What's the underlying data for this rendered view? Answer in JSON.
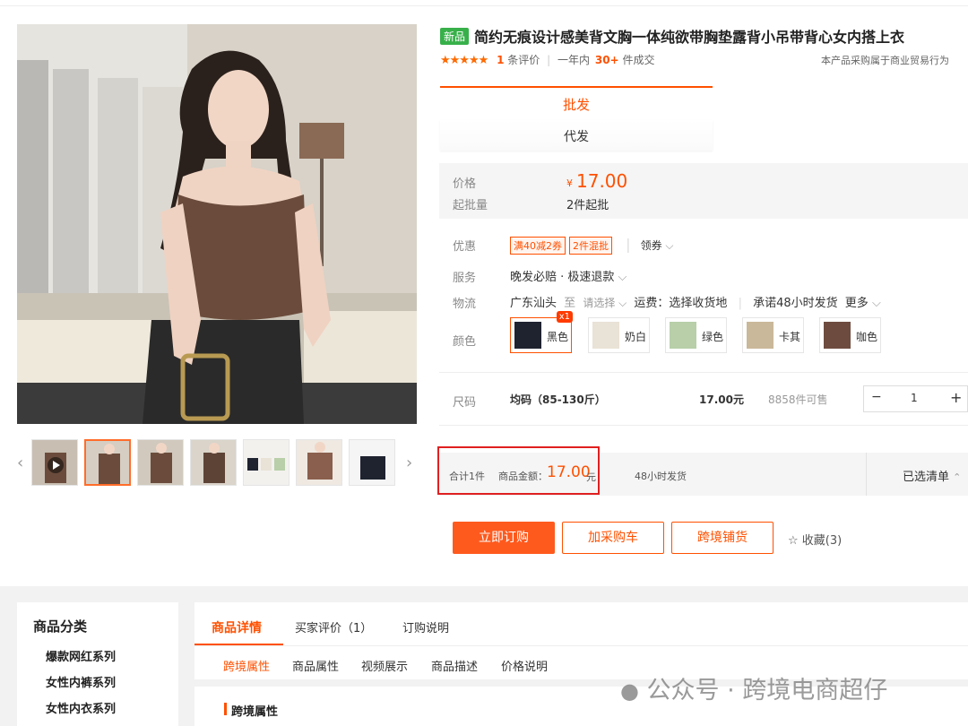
{
  "product": {
    "new_tag": "新品",
    "title": "简约无痕设计感美背文胸一体纯欲带胸垫露背小吊带背心女内搭上衣",
    "stars": "★★★★★",
    "review_count": "1",
    "review_unit": "条评价",
    "period": "一年内",
    "sales": "30+",
    "sales_unit": "件成交",
    "statement": "本产品采购属于商业贸易行为"
  },
  "mode_tabs": [
    "批发",
    "代发"
  ],
  "price": {
    "label": "价格",
    "currency": "¥",
    "value": "17.00",
    "moq_label": "起批量",
    "moq": "2件起批"
  },
  "promo": {
    "label": "优惠",
    "coupons": [
      "满40减2券",
      "2件混批"
    ],
    "get_coupon": "领券"
  },
  "service": {
    "label": "服务",
    "value": "晚发必赔 · 极速退款"
  },
  "logistics": {
    "label": "物流",
    "origin": "广东汕头",
    "to": "至",
    "select": "请选择",
    "fee": "运费：选择收货地",
    "promise": "承诺48小时发货",
    "more": "更多"
  },
  "colors": {
    "label": "颜色",
    "options": [
      {
        "name": "黑色",
        "badge": "x1",
        "color": "#1f2330"
      },
      {
        "name": "奶白",
        "color": "#e9e2d6"
      },
      {
        "name": "绿色",
        "color": "#b8cfa9"
      },
      {
        "name": "卡其",
        "color": "#c9b89a"
      },
      {
        "name": "咖色",
        "color": "#6d4c3f"
      }
    ]
  },
  "size": {
    "label": "尺码",
    "value": "均码（85-130斤）",
    "price": "17.00元",
    "stock": "8858件可售",
    "qty": "1",
    "minus": "−",
    "plus": "+"
  },
  "summary": {
    "total": "合计1件",
    "amount_label": "商品金额：",
    "amount": "17.00",
    "unit": "元",
    "ship": "48小时发货",
    "selected": "已选清单"
  },
  "actions": {
    "buy": "立即订购",
    "cart": "加采购车",
    "cross": "跨境铺货",
    "fav": "收藏(3)"
  },
  "category": {
    "title": "商品分类",
    "items": [
      "爆款网红系列",
      "女性内裤系列",
      "女性内衣系列"
    ]
  },
  "detail_tabs": [
    "商品详情",
    "买家评价（1）",
    "订购说明"
  ],
  "sub_tabs": [
    "跨境属性",
    "商品属性",
    "视频展示",
    "商品描述",
    "价格说明"
  ],
  "section_title": "跨境属性",
  "watermark": "公众号 · 跨境电商超仔"
}
